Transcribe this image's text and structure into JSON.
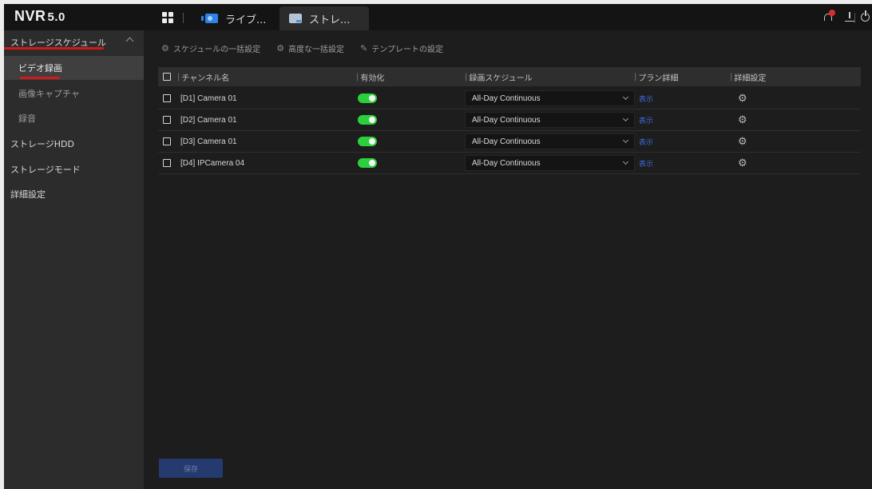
{
  "app": {
    "logo": "NVR",
    "version": "5.0"
  },
  "tabs": [
    {
      "label": "ライブ...",
      "icon": "live-view-icon"
    },
    {
      "label": "ストレ...",
      "icon": "storage-icon"
    }
  ],
  "topbar_icons": [
    "grid-menu-icon",
    "alarm-bell-icon",
    "download-icon",
    "power-icon"
  ],
  "sidebar": {
    "section": "ストレージスケジュール",
    "subitems": [
      "ビデオ録画",
      "画像キャプチャ",
      "録音"
    ],
    "items": [
      "ストレージHDD",
      "ストレージモード",
      "詳細設定"
    ]
  },
  "toolbar": {
    "batch_schedule": "スケジュールの一括設定",
    "advanced_batch": "高度な一括設定",
    "template": "テンプレートの設定"
  },
  "table": {
    "headers": {
      "channel": "チャンネル名",
      "enable": "有効化",
      "schedule": "録画スケジュール",
      "plan": "プラン詳細",
      "advanced": "詳細設定"
    },
    "rows": [
      {
        "channel": "[D1] Camera 01",
        "enabled": true,
        "schedule": "All-Day Continuous",
        "plan": "表示"
      },
      {
        "channel": "[D2] Camera 01",
        "enabled": true,
        "schedule": "All-Day Continuous",
        "plan": "表示"
      },
      {
        "channel": "[D3] Camera 01",
        "enabled": true,
        "schedule": "All-Day Continuous",
        "plan": "表示"
      },
      {
        "channel": "[D4] IPCamera 04",
        "enabled": true,
        "schedule": "All-Day Continuous",
        "plan": "表示"
      }
    ]
  },
  "save_label": "保存",
  "colors": {
    "accent": "#2f83e8",
    "toggle_on": "#2bd13d",
    "highlight_red": "#d21a1a",
    "link": "#3a6bd8"
  }
}
